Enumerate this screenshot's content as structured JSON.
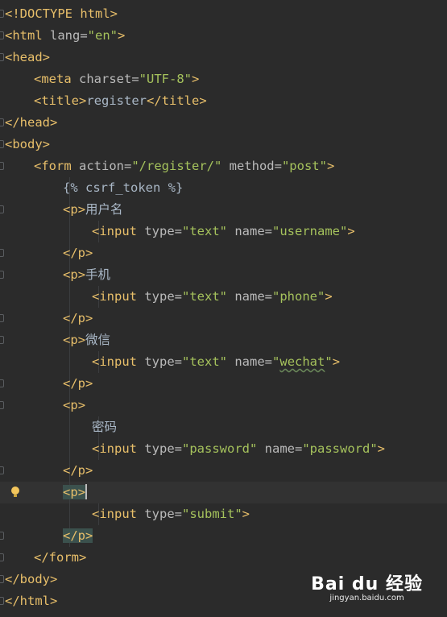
{
  "code_lines": [
    {
      "indent": 0,
      "fold": true,
      "parts": [
        {
          "c": "br",
          "t": "<!DOCTYPE html>"
        }
      ]
    },
    {
      "indent": 0,
      "fold": true,
      "parts": [
        {
          "c": "br",
          "t": "<"
        },
        {
          "c": "tg",
          "t": "html"
        },
        {
          "c": "at",
          "t": " lang="
        },
        {
          "c": "vl",
          "t": "\"en\""
        },
        {
          "c": "br",
          "t": ">"
        }
      ]
    },
    {
      "indent": 0,
      "fold": true,
      "parts": [
        {
          "c": "br",
          "t": "<"
        },
        {
          "c": "tg",
          "t": "head"
        },
        {
          "c": "br",
          "t": ">"
        }
      ]
    },
    {
      "indent": 1,
      "fold": false,
      "parts": [
        {
          "c": "br",
          "t": "<"
        },
        {
          "c": "tg",
          "t": "meta"
        },
        {
          "c": "at",
          "t": " charset="
        },
        {
          "c": "vl",
          "t": "\"UTF-8\""
        },
        {
          "c": "br",
          "t": ">"
        }
      ]
    },
    {
      "indent": 1,
      "fold": false,
      "parts": [
        {
          "c": "br",
          "t": "<"
        },
        {
          "c": "tg",
          "t": "title"
        },
        {
          "c": "br",
          "t": ">"
        },
        {
          "c": "tx",
          "t": "register"
        },
        {
          "c": "br",
          "t": "</"
        },
        {
          "c": "tg",
          "t": "title"
        },
        {
          "c": "br",
          "t": ">"
        }
      ]
    },
    {
      "indent": 0,
      "fold": true,
      "parts": [
        {
          "c": "br",
          "t": "</"
        },
        {
          "c": "tg",
          "t": "head"
        },
        {
          "c": "br",
          "t": ">"
        }
      ]
    },
    {
      "indent": 0,
      "fold": true,
      "parts": [
        {
          "c": "br",
          "t": "<"
        },
        {
          "c": "tg",
          "t": "body"
        },
        {
          "c": "br",
          "t": ">"
        }
      ]
    },
    {
      "indent": 1,
      "fold": true,
      "parts": [
        {
          "c": "br",
          "t": "<"
        },
        {
          "c": "tg",
          "t": "form"
        },
        {
          "c": "at",
          "t": " action="
        },
        {
          "c": "vl",
          "t": "\"/register/\""
        },
        {
          "c": "at",
          "t": " method="
        },
        {
          "c": "vl",
          "t": "\"post\""
        },
        {
          "c": "br",
          "t": ">"
        }
      ]
    },
    {
      "indent": 2,
      "fold": false,
      "parts": [
        {
          "c": "dj",
          "t": "{% csrf_token %}"
        }
      ]
    },
    {
      "indent": 2,
      "fold": true,
      "parts": [
        {
          "c": "br",
          "t": "<"
        },
        {
          "c": "tg",
          "t": "p"
        },
        {
          "c": "br",
          "t": ">"
        },
        {
          "c": "tx",
          "t": "用户名"
        }
      ]
    },
    {
      "indent": 3,
      "fold": false,
      "parts": [
        {
          "c": "br",
          "t": "<"
        },
        {
          "c": "tg",
          "t": "input"
        },
        {
          "c": "at",
          "t": " type="
        },
        {
          "c": "vl",
          "t": "\"text\""
        },
        {
          "c": "at",
          "t": " name="
        },
        {
          "c": "vl",
          "t": "\"username\""
        },
        {
          "c": "br",
          "t": ">"
        }
      ]
    },
    {
      "indent": 2,
      "fold": true,
      "parts": [
        {
          "c": "br",
          "t": "</"
        },
        {
          "c": "tg",
          "t": "p"
        },
        {
          "c": "br",
          "t": ">"
        }
      ]
    },
    {
      "indent": 2,
      "fold": true,
      "parts": [
        {
          "c": "br",
          "t": "<"
        },
        {
          "c": "tg",
          "t": "p"
        },
        {
          "c": "br",
          "t": ">"
        },
        {
          "c": "tx",
          "t": "手机"
        }
      ]
    },
    {
      "indent": 3,
      "fold": false,
      "parts": [
        {
          "c": "br",
          "t": "<"
        },
        {
          "c": "tg",
          "t": "input"
        },
        {
          "c": "at",
          "t": " type="
        },
        {
          "c": "vl",
          "t": "\"text\""
        },
        {
          "c": "at",
          "t": " name="
        },
        {
          "c": "vl",
          "t": "\"phone\""
        },
        {
          "c": "br",
          "t": ">"
        }
      ]
    },
    {
      "indent": 2,
      "fold": true,
      "parts": [
        {
          "c": "br",
          "t": "</"
        },
        {
          "c": "tg",
          "t": "p"
        },
        {
          "c": "br",
          "t": ">"
        }
      ]
    },
    {
      "indent": 2,
      "fold": true,
      "parts": [
        {
          "c": "br",
          "t": "<"
        },
        {
          "c": "tg",
          "t": "p"
        },
        {
          "c": "br",
          "t": ">"
        },
        {
          "c": "tx",
          "t": "微信"
        }
      ]
    },
    {
      "indent": 3,
      "fold": false,
      "parts": [
        {
          "c": "br",
          "t": "<"
        },
        {
          "c": "tg",
          "t": "input"
        },
        {
          "c": "at",
          "t": " type="
        },
        {
          "c": "vl",
          "t": "\"text\""
        },
        {
          "c": "at",
          "t": " name="
        },
        {
          "c": "vl",
          "t": "\""
        },
        {
          "c": "vl typo",
          "t": "wechat"
        },
        {
          "c": "vl",
          "t": "\""
        },
        {
          "c": "br",
          "t": ">"
        }
      ]
    },
    {
      "indent": 2,
      "fold": true,
      "parts": [
        {
          "c": "br",
          "t": "</"
        },
        {
          "c": "tg",
          "t": "p"
        },
        {
          "c": "br",
          "t": ">"
        }
      ]
    },
    {
      "indent": 2,
      "fold": true,
      "parts": [
        {
          "c": "br",
          "t": "<"
        },
        {
          "c": "tg",
          "t": "p"
        },
        {
          "c": "br",
          "t": ">"
        }
      ]
    },
    {
      "indent": 3,
      "fold": false,
      "parts": [
        {
          "c": "tx",
          "t": "密码"
        }
      ]
    },
    {
      "indent": 3,
      "fold": false,
      "parts": [
        {
          "c": "br",
          "t": "<"
        },
        {
          "c": "tg",
          "t": "input"
        },
        {
          "c": "at",
          "t": " type="
        },
        {
          "c": "vl",
          "t": "\"password\""
        },
        {
          "c": "at",
          "t": " name="
        },
        {
          "c": "vl",
          "t": "\"password\""
        },
        {
          "c": "br",
          "t": ">"
        }
      ]
    },
    {
      "indent": 2,
      "fold": true,
      "parts": [
        {
          "c": "br",
          "t": "</"
        },
        {
          "c": "tg",
          "t": "p"
        },
        {
          "c": "br",
          "t": ">"
        }
      ]
    },
    {
      "indent": 2,
      "fold": false,
      "current": true,
      "bulb": true,
      "caret": true,
      "parts": [
        {
          "c": "br match",
          "t": "<"
        },
        {
          "c": "tg match",
          "t": "p"
        },
        {
          "c": "br match",
          "t": ">"
        }
      ]
    },
    {
      "indent": 3,
      "fold": false,
      "parts": [
        {
          "c": "br",
          "t": "<"
        },
        {
          "c": "tg",
          "t": "input"
        },
        {
          "c": "at",
          "t": " type="
        },
        {
          "c": "vl",
          "t": "\"submit\""
        },
        {
          "c": "br",
          "t": ">"
        }
      ]
    },
    {
      "indent": 2,
      "fold": true,
      "parts": [
        {
          "c": "br match",
          "t": "</"
        },
        {
          "c": "tg match",
          "t": "p"
        },
        {
          "c": "br match",
          "t": ">"
        }
      ]
    },
    {
      "indent": 1,
      "fold": true,
      "parts": [
        {
          "c": "br",
          "t": "</"
        },
        {
          "c": "tg",
          "t": "form"
        },
        {
          "c": "br",
          "t": ">"
        }
      ]
    },
    {
      "indent": 0,
      "fold": true,
      "parts": [
        {
          "c": "br",
          "t": "</"
        },
        {
          "c": "tg",
          "t": "body"
        },
        {
          "c": "br",
          "t": ">"
        }
      ]
    },
    {
      "indent": 0,
      "fold": true,
      "parts": [
        {
          "c": "br",
          "t": "</"
        },
        {
          "c": "tg",
          "t": "html"
        },
        {
          "c": "br",
          "t": ">"
        }
      ]
    }
  ],
  "watermark": {
    "brand": "Bai du 经验",
    "url": "jingyan.baidu.com"
  },
  "colors": {
    "background": "#2b2b2b",
    "tag": "#e8bf6a",
    "attribute": "#bababa",
    "value": "#a5c25c",
    "text": "#a9b7c6",
    "current_line": "#323232",
    "brace_match": "#3b514d"
  }
}
